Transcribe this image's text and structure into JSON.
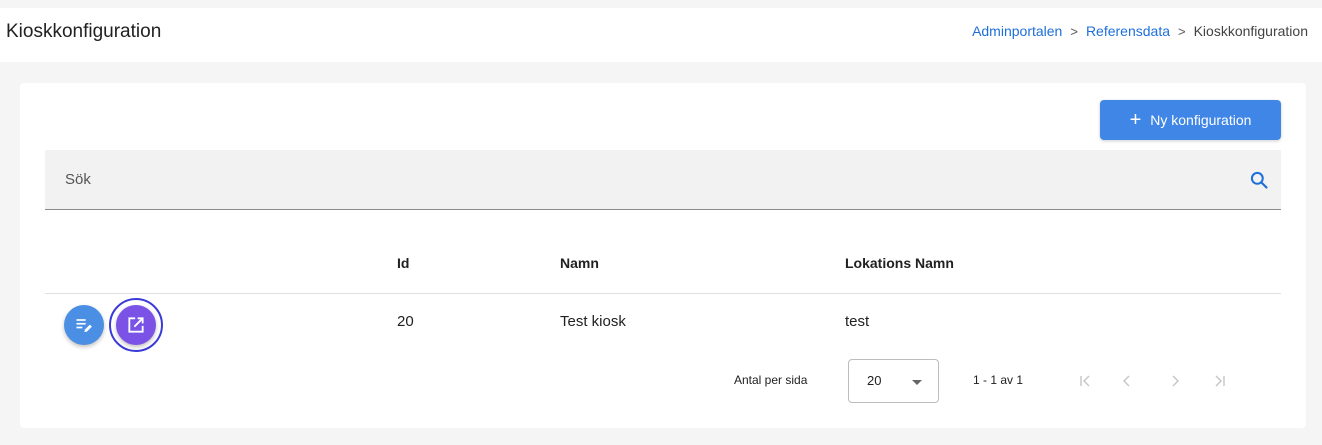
{
  "header": {
    "title": "Kioskkonfiguration",
    "breadcrumb": [
      "Adminportalen",
      "Referensdata",
      "Kioskkonfiguration"
    ]
  },
  "toolbar": {
    "add_icon": "plus-icon",
    "add_label": "Ny konfiguration"
  },
  "search": {
    "placeholder": "Sök",
    "value": "",
    "icon": "search-icon"
  },
  "table": {
    "columns": [
      "",
      "Id",
      "Namn",
      "Lokations Namn"
    ],
    "rows": [
      {
        "actions": [
          "edit-list-icon",
          "open-in-new-icon"
        ],
        "id": "20",
        "name": "Test kiosk",
        "location": "test"
      }
    ]
  },
  "pagination": {
    "per_page_label": "Antal per sida",
    "per_page_value": "20",
    "range_label": "1 - 1 av 1",
    "nav": [
      "first-page-icon",
      "previous-page-icon",
      "next-page-icon",
      "last-page-icon"
    ]
  },
  "colors": {
    "primary": "#3f86e6",
    "link": "#1e6fd9",
    "edit_button": "#4a8fe3",
    "open_button": "#7a52e6",
    "focus_ring": "#3a3ad9"
  }
}
